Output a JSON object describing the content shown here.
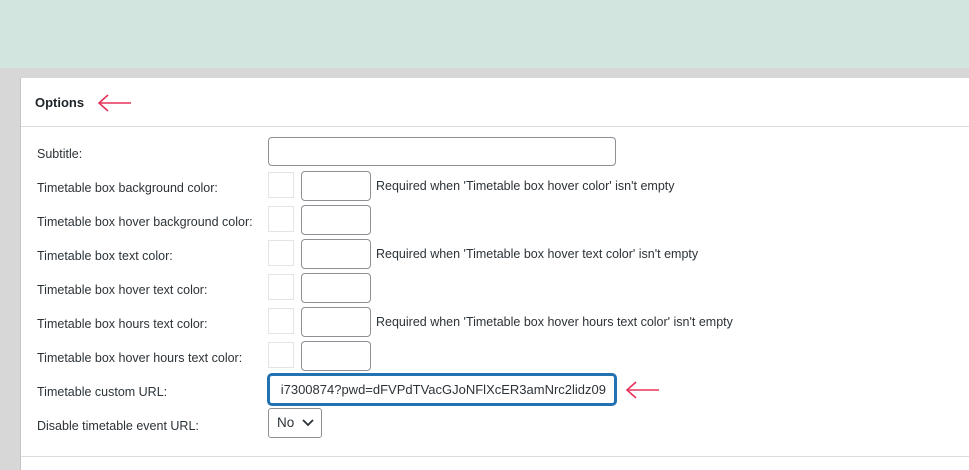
{
  "panel": {
    "title": "Options"
  },
  "fields": {
    "subtitle": {
      "label": "Subtitle:",
      "value": ""
    },
    "box_bg_color": {
      "label": "Timetable box background color:",
      "hint": "Required when 'Timetable box hover color' isn't empty"
    },
    "box_hover_bg_color": {
      "label": "Timetable box hover background color:"
    },
    "box_text_color": {
      "label": "Timetable box text color:",
      "hint": "Required when 'Timetable box hover text color' isn't empty"
    },
    "box_hover_text_color": {
      "label": "Timetable box hover text color:"
    },
    "box_hours_text_color": {
      "label": "Timetable box hours text color:",
      "hint": "Required when 'Timetable box hover hours text color' isn't empty"
    },
    "box_hover_hours_text_color": {
      "label": "Timetable box hover hours text color:"
    },
    "custom_url": {
      "label": "Timetable custom URL:",
      "value": "i7300874?pwd=dFVPdTVacGJoNFlXcER3amNrc2lidz09"
    },
    "disable_event_url": {
      "label": "Disable timetable event URL:",
      "selected": "No"
    }
  },
  "colors": {
    "header_band": "#d2e5df",
    "annotation_arrow": "#e8325a",
    "focus_border": "#2271b1"
  },
  "icons": {
    "annotation": "left-arrow-icon",
    "select": "chevron-down-icon"
  }
}
